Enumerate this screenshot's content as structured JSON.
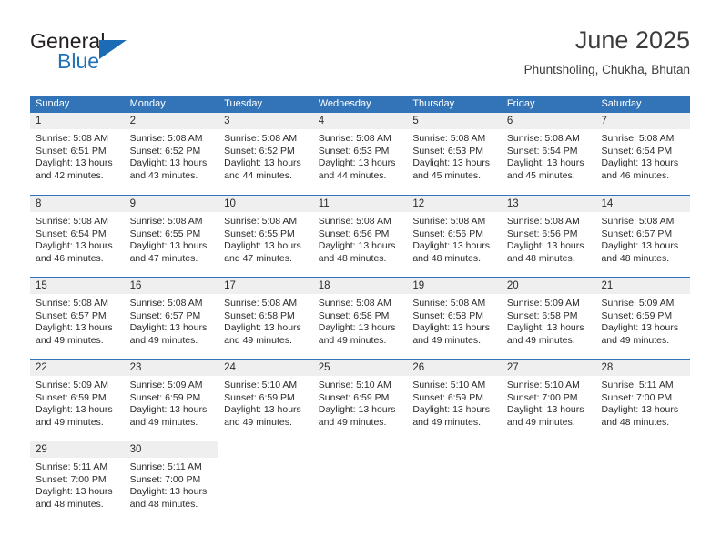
{
  "logo": {
    "word_top": "General",
    "word_bottom": "Blue",
    "accent_color": "#2272b9",
    "triangle_icon": "triangle-icon"
  },
  "header": {
    "title": "June 2025",
    "subtitle": "Phuntsholing, Chukha, Bhutan"
  },
  "calendar": {
    "header_bg": "#3274b7",
    "daynum_bg": "#efefef",
    "weekdays": [
      "Sunday",
      "Monday",
      "Tuesday",
      "Wednesday",
      "Thursday",
      "Friday",
      "Saturday"
    ],
    "weeks": [
      [
        {
          "day": "1",
          "sunrise": "Sunrise: 5:08 AM",
          "sunset": "Sunset: 6:51 PM",
          "daylight_line1": "Daylight: 13 hours",
          "daylight_line2": "and 42 minutes."
        },
        {
          "day": "2",
          "sunrise": "Sunrise: 5:08 AM",
          "sunset": "Sunset: 6:52 PM",
          "daylight_line1": "Daylight: 13 hours",
          "daylight_line2": "and 43 minutes."
        },
        {
          "day": "3",
          "sunrise": "Sunrise: 5:08 AM",
          "sunset": "Sunset: 6:52 PM",
          "daylight_line1": "Daylight: 13 hours",
          "daylight_line2": "and 44 minutes."
        },
        {
          "day": "4",
          "sunrise": "Sunrise: 5:08 AM",
          "sunset": "Sunset: 6:53 PM",
          "daylight_line1": "Daylight: 13 hours",
          "daylight_line2": "and 44 minutes."
        },
        {
          "day": "5",
          "sunrise": "Sunrise: 5:08 AM",
          "sunset": "Sunset: 6:53 PM",
          "daylight_line1": "Daylight: 13 hours",
          "daylight_line2": "and 45 minutes."
        },
        {
          "day": "6",
          "sunrise": "Sunrise: 5:08 AM",
          "sunset": "Sunset: 6:54 PM",
          "daylight_line1": "Daylight: 13 hours",
          "daylight_line2": "and 45 minutes."
        },
        {
          "day": "7",
          "sunrise": "Sunrise: 5:08 AM",
          "sunset": "Sunset: 6:54 PM",
          "daylight_line1": "Daylight: 13 hours",
          "daylight_line2": "and 46 minutes."
        }
      ],
      [
        {
          "day": "8",
          "sunrise": "Sunrise: 5:08 AM",
          "sunset": "Sunset: 6:54 PM",
          "daylight_line1": "Daylight: 13 hours",
          "daylight_line2": "and 46 minutes."
        },
        {
          "day": "9",
          "sunrise": "Sunrise: 5:08 AM",
          "sunset": "Sunset: 6:55 PM",
          "daylight_line1": "Daylight: 13 hours",
          "daylight_line2": "and 47 minutes."
        },
        {
          "day": "10",
          "sunrise": "Sunrise: 5:08 AM",
          "sunset": "Sunset: 6:55 PM",
          "daylight_line1": "Daylight: 13 hours",
          "daylight_line2": "and 47 minutes."
        },
        {
          "day": "11",
          "sunrise": "Sunrise: 5:08 AM",
          "sunset": "Sunset: 6:56 PM",
          "daylight_line1": "Daylight: 13 hours",
          "daylight_line2": "and 48 minutes."
        },
        {
          "day": "12",
          "sunrise": "Sunrise: 5:08 AM",
          "sunset": "Sunset: 6:56 PM",
          "daylight_line1": "Daylight: 13 hours",
          "daylight_line2": "and 48 minutes."
        },
        {
          "day": "13",
          "sunrise": "Sunrise: 5:08 AM",
          "sunset": "Sunset: 6:56 PM",
          "daylight_line1": "Daylight: 13 hours",
          "daylight_line2": "and 48 minutes."
        },
        {
          "day": "14",
          "sunrise": "Sunrise: 5:08 AM",
          "sunset": "Sunset: 6:57 PM",
          "daylight_line1": "Daylight: 13 hours",
          "daylight_line2": "and 48 minutes."
        }
      ],
      [
        {
          "day": "15",
          "sunrise": "Sunrise: 5:08 AM",
          "sunset": "Sunset: 6:57 PM",
          "daylight_line1": "Daylight: 13 hours",
          "daylight_line2": "and 49 minutes."
        },
        {
          "day": "16",
          "sunrise": "Sunrise: 5:08 AM",
          "sunset": "Sunset: 6:57 PM",
          "daylight_line1": "Daylight: 13 hours",
          "daylight_line2": "and 49 minutes."
        },
        {
          "day": "17",
          "sunrise": "Sunrise: 5:08 AM",
          "sunset": "Sunset: 6:58 PM",
          "daylight_line1": "Daylight: 13 hours",
          "daylight_line2": "and 49 minutes."
        },
        {
          "day": "18",
          "sunrise": "Sunrise: 5:08 AM",
          "sunset": "Sunset: 6:58 PM",
          "daylight_line1": "Daylight: 13 hours",
          "daylight_line2": "and 49 minutes."
        },
        {
          "day": "19",
          "sunrise": "Sunrise: 5:08 AM",
          "sunset": "Sunset: 6:58 PM",
          "daylight_line1": "Daylight: 13 hours",
          "daylight_line2": "and 49 minutes."
        },
        {
          "day": "20",
          "sunrise": "Sunrise: 5:09 AM",
          "sunset": "Sunset: 6:58 PM",
          "daylight_line1": "Daylight: 13 hours",
          "daylight_line2": "and 49 minutes."
        },
        {
          "day": "21",
          "sunrise": "Sunrise: 5:09 AM",
          "sunset": "Sunset: 6:59 PM",
          "daylight_line1": "Daylight: 13 hours",
          "daylight_line2": "and 49 minutes."
        }
      ],
      [
        {
          "day": "22",
          "sunrise": "Sunrise: 5:09 AM",
          "sunset": "Sunset: 6:59 PM",
          "daylight_line1": "Daylight: 13 hours",
          "daylight_line2": "and 49 minutes."
        },
        {
          "day": "23",
          "sunrise": "Sunrise: 5:09 AM",
          "sunset": "Sunset: 6:59 PM",
          "daylight_line1": "Daylight: 13 hours",
          "daylight_line2": "and 49 minutes."
        },
        {
          "day": "24",
          "sunrise": "Sunrise: 5:10 AM",
          "sunset": "Sunset: 6:59 PM",
          "daylight_line1": "Daylight: 13 hours",
          "daylight_line2": "and 49 minutes."
        },
        {
          "day": "25",
          "sunrise": "Sunrise: 5:10 AM",
          "sunset": "Sunset: 6:59 PM",
          "daylight_line1": "Daylight: 13 hours",
          "daylight_line2": "and 49 minutes."
        },
        {
          "day": "26",
          "sunrise": "Sunrise: 5:10 AM",
          "sunset": "Sunset: 6:59 PM",
          "daylight_line1": "Daylight: 13 hours",
          "daylight_line2": "and 49 minutes."
        },
        {
          "day": "27",
          "sunrise": "Sunrise: 5:10 AM",
          "sunset": "Sunset: 7:00 PM",
          "daylight_line1": "Daylight: 13 hours",
          "daylight_line2": "and 49 minutes."
        },
        {
          "day": "28",
          "sunrise": "Sunrise: 5:11 AM",
          "sunset": "Sunset: 7:00 PM",
          "daylight_line1": "Daylight: 13 hours",
          "daylight_line2": "and 48 minutes."
        }
      ],
      [
        {
          "day": "29",
          "sunrise": "Sunrise: 5:11 AM",
          "sunset": "Sunset: 7:00 PM",
          "daylight_line1": "Daylight: 13 hours",
          "daylight_line2": "and 48 minutes."
        },
        {
          "day": "30",
          "sunrise": "Sunrise: 5:11 AM",
          "sunset": "Sunset: 7:00 PM",
          "daylight_line1": "Daylight: 13 hours",
          "daylight_line2": "and 48 minutes."
        },
        {
          "day": "",
          "sunrise": "",
          "sunset": "",
          "daylight_line1": "",
          "daylight_line2": ""
        },
        {
          "day": "",
          "sunrise": "",
          "sunset": "",
          "daylight_line1": "",
          "daylight_line2": ""
        },
        {
          "day": "",
          "sunrise": "",
          "sunset": "",
          "daylight_line1": "",
          "daylight_line2": ""
        },
        {
          "day": "",
          "sunrise": "",
          "sunset": "",
          "daylight_line1": "",
          "daylight_line2": ""
        },
        {
          "day": "",
          "sunrise": "",
          "sunset": "",
          "daylight_line1": "",
          "daylight_line2": ""
        }
      ]
    ]
  }
}
